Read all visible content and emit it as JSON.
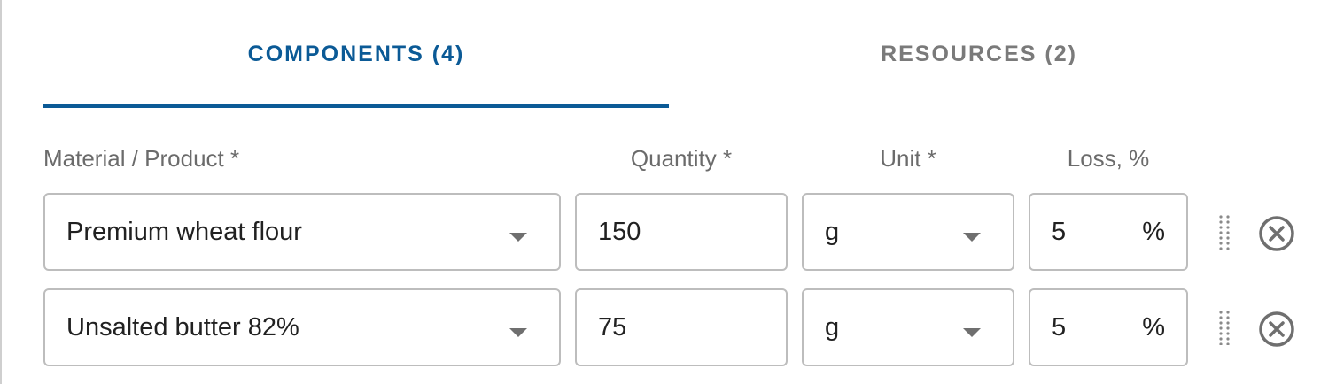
{
  "tabs": [
    {
      "label": "COMPONENTS (4)",
      "active": true
    },
    {
      "label": "RESOURCES (2)",
      "active": false
    }
  ],
  "colors": {
    "accent": "#0b5a96",
    "inactive_tab": "#7a7a7a",
    "field_border": "#bdbdbd",
    "icon": "#6f6f6f"
  },
  "columns": {
    "material": "Material / Product *",
    "quantity": "Quantity *",
    "unit": "Unit *",
    "loss": "Loss, %"
  },
  "rows": [
    {
      "material": "Premium wheat flour",
      "quantity": "150",
      "unit": "g",
      "loss": "5",
      "loss_suffix": "%"
    },
    {
      "material": "Unsalted butter 82%",
      "quantity": "75",
      "unit": "g",
      "loss": "5",
      "loss_suffix": "%"
    }
  ],
  "icons": {
    "dropdown": "chevron-down-icon",
    "drag": "drag-handle-icon",
    "remove": "close-circle-icon"
  }
}
